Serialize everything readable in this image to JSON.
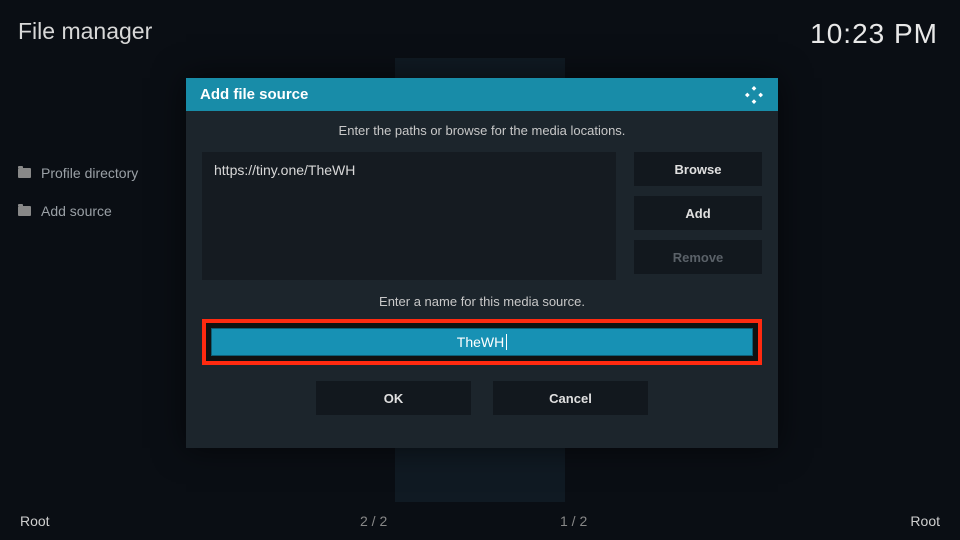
{
  "header": {
    "title": "File manager",
    "clock": "10:23 PM"
  },
  "sidebar": {
    "items": [
      {
        "label": "Profile directory"
      },
      {
        "label": "Add source"
      }
    ]
  },
  "dialog": {
    "title": "Add file source",
    "instruction_paths": "Enter the paths or browse for the media locations.",
    "path_value": "https://tiny.one/TheWH",
    "buttons": {
      "browse": "Browse",
      "add": "Add",
      "remove": "Remove"
    },
    "instruction_name": "Enter a name for this media source.",
    "name_value": "TheWH",
    "ok": "OK",
    "cancel": "Cancel"
  },
  "footer": {
    "left_label": "Root",
    "pager_left": "2 / 2",
    "pager_right": "1 / 2",
    "right_label": "Root"
  }
}
